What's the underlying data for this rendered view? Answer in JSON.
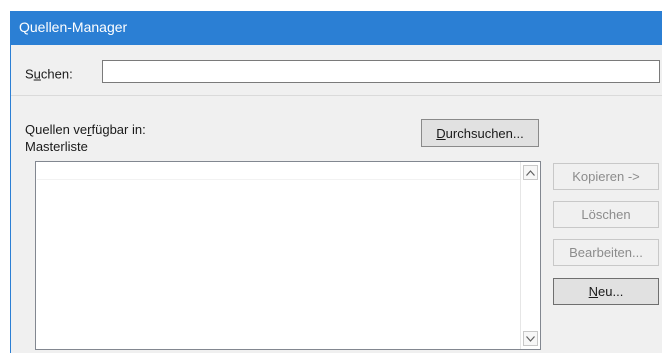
{
  "window": {
    "title": "Quellen-Manager"
  },
  "search": {
    "label_pre": "S",
    "label_accel": "u",
    "label_post": "chen:",
    "value": ""
  },
  "sources": {
    "label_pre": "Quellen ve",
    "label_accel": "r",
    "label_post": "fügbar in:",
    "current_list": "Masterliste",
    "items": []
  },
  "browse_button": {
    "accel": "D",
    "rest": "urchsuchen..."
  },
  "side_buttons": {
    "copy": "Kopieren ->",
    "delete": "Löschen",
    "edit": "Bearbeiten...",
    "new_accel": "N",
    "new_rest": "eu..."
  },
  "icons": {
    "scroll_up": "chevron-up-icon",
    "scroll_down": "chevron-down-icon"
  },
  "colors": {
    "titlebar": "#2b7fd4",
    "window_bg": "#f0f0f0",
    "disabled_text": "#8c8c8c"
  }
}
